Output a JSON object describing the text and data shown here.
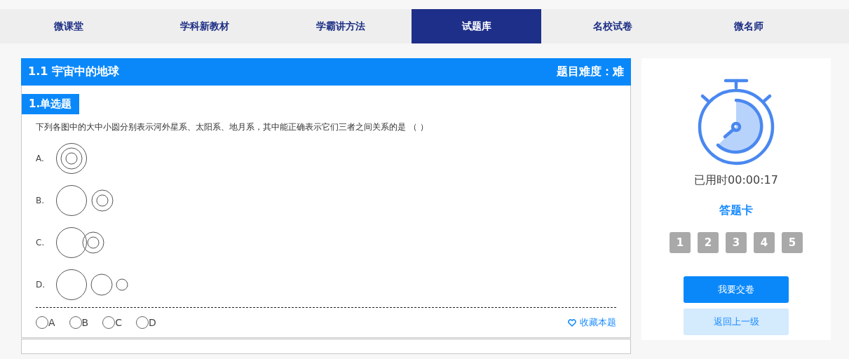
{
  "nav_tabs": [
    {
      "label": "微课堂",
      "selected": false
    },
    {
      "label": "学科新教材",
      "selected": false
    },
    {
      "label": "学霸讲方法",
      "selected": false
    },
    {
      "label": "试题库",
      "selected": true
    },
    {
      "label": "名校试卷",
      "selected": false
    },
    {
      "label": "微名师",
      "selected": false
    }
  ],
  "section": {
    "title": "1.1 宇宙中的地球",
    "difficulty": "题目难度：难"
  },
  "question": {
    "type_label": "1.单选题",
    "text": "下列各图中的大中小圆分别表示河外星系、太阳系、地月系，其中能正确表示它们三者之间关系的是 （ ）",
    "options": [
      {
        "label": "A.",
        "kind": "nested"
      },
      {
        "label": "B.",
        "kind": "separate"
      },
      {
        "label": "C.",
        "kind": "overlap"
      },
      {
        "label": "D.",
        "kind": "row"
      }
    ],
    "answers": [
      {
        "label": "A",
        "selected": false
      },
      {
        "label": "B",
        "selected": false
      },
      {
        "label": "C",
        "selected": false
      },
      {
        "label": "D",
        "selected": false
      }
    ],
    "favorite": "收藏本题"
  },
  "sidebar": {
    "elapsed": "已用时00:00:17",
    "card_title": "答题卡",
    "numbers": [
      "1",
      "2",
      "3",
      "4",
      "5"
    ],
    "submit": "我要交卷",
    "back": "返回上一级"
  }
}
